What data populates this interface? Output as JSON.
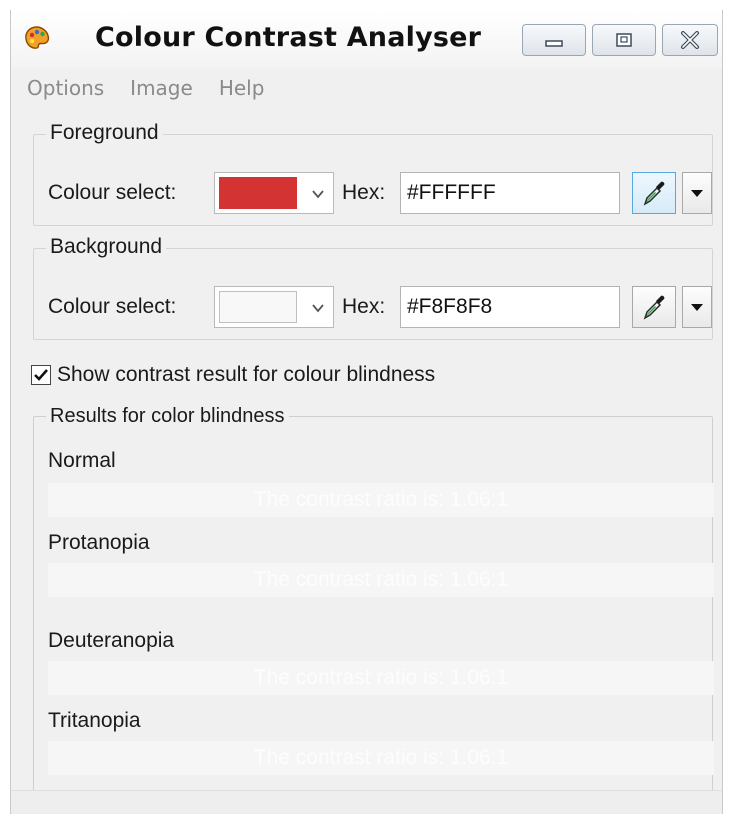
{
  "window": {
    "title": "Colour Contrast Analyser"
  },
  "menu": [
    "Options",
    "Image",
    "Help"
  ],
  "foreground": {
    "group_label": "Foreground",
    "colour_select_label": "Colour select:",
    "swatch_color": "#d43333",
    "hex_label": "Hex:",
    "hex_value": "#FFFFFF"
  },
  "background": {
    "group_label": "Background",
    "colour_select_label": "Colour select:",
    "swatch_color": "#f8f8f8",
    "hex_label": "Hex:",
    "hex_value": "#F8F8F8"
  },
  "colour_blindness_checkbox": {
    "label": "Show contrast result for colour blindness",
    "checked": true
  },
  "results": {
    "group_label": "Results for color blindness",
    "items": [
      {
        "label": "Normal",
        "result": "The contrast ratio is: 1.06:1"
      },
      {
        "label": "Protanopia",
        "result": "The contrast ratio is: 1.06:1"
      },
      {
        "label": "Deuteranopia",
        "result": "The contrast ratio is: 1.06:1"
      },
      {
        "label": "Tritanopia",
        "result": "The contrast ratio is: 1.06:1"
      }
    ]
  },
  "icons": {
    "app": "palette-icon",
    "minimize": "minimize-icon",
    "maximize": "maximize-icon",
    "close": "close-icon",
    "picker": "eyedropper-icon",
    "dropdown": "chevron-down-icon"
  }
}
